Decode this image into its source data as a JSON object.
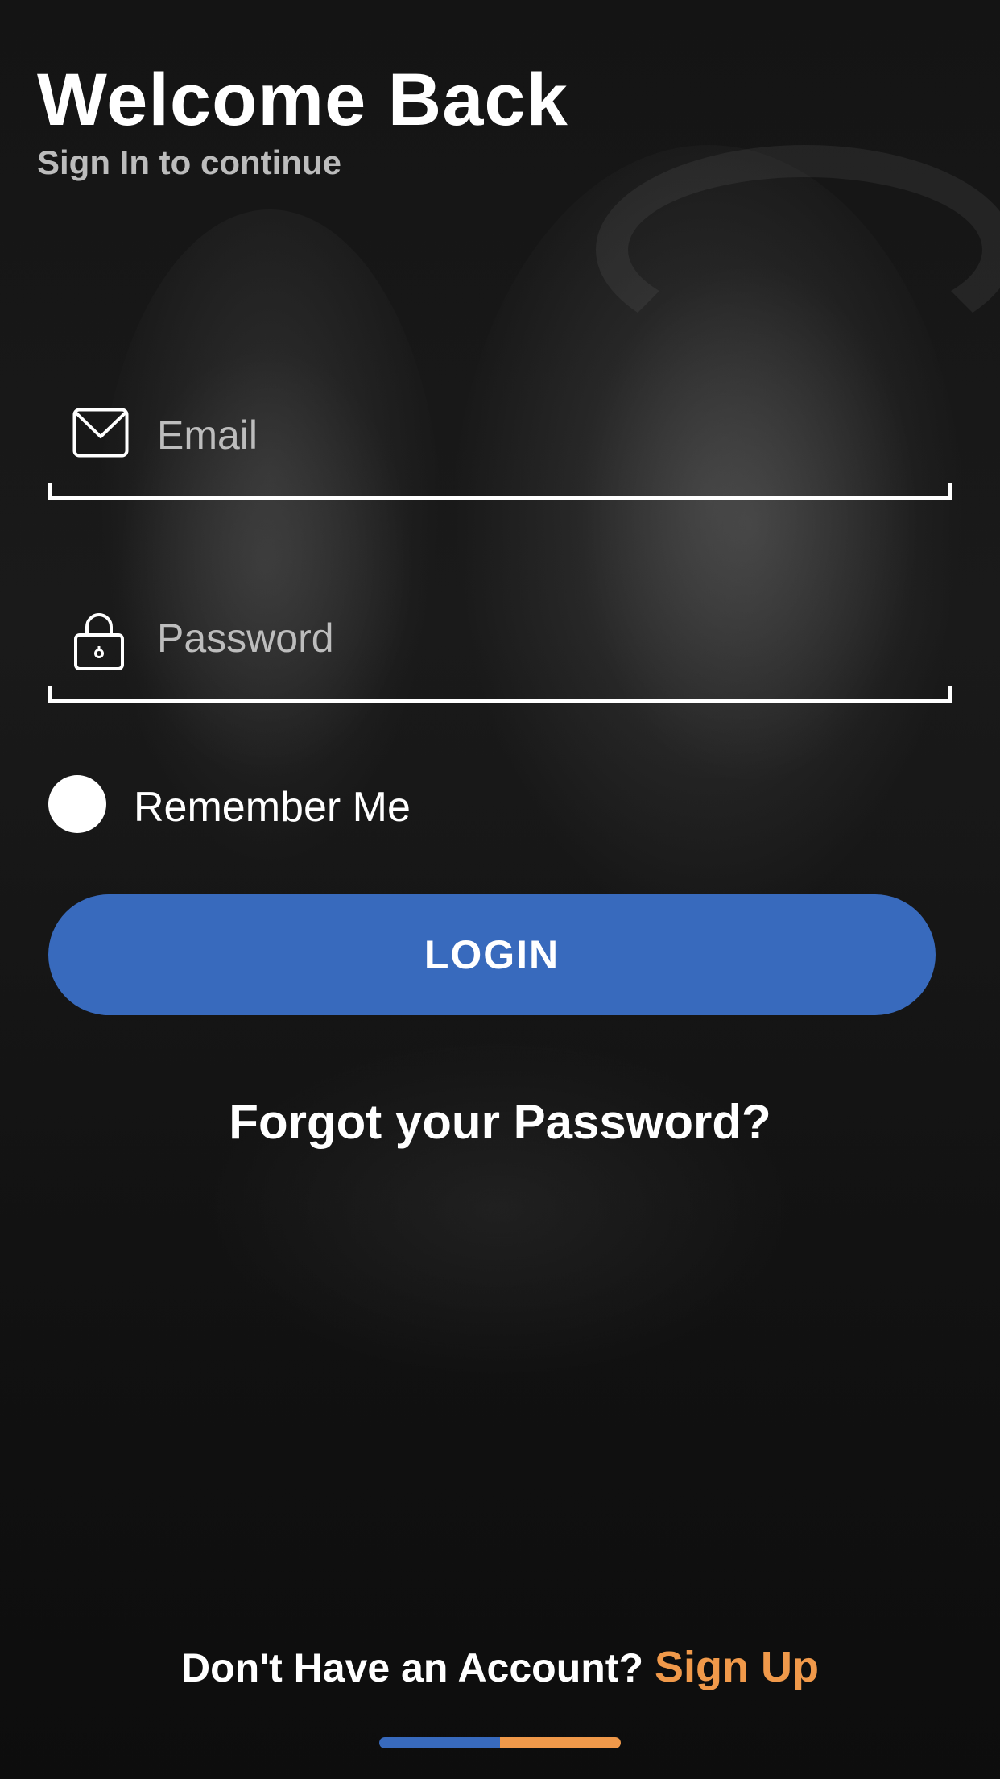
{
  "header": {
    "title": "Welcome Back",
    "subtitle": "Sign In to continue"
  },
  "form": {
    "email": {
      "placeholder": "Email",
      "value": "",
      "icon": "mail-icon"
    },
    "password": {
      "placeholder": "Password",
      "value": "",
      "icon": "lock-icon"
    },
    "remember_me": {
      "label": "Remember Me",
      "checked": false
    },
    "login_label": "LOGIN",
    "forgot_label": "Forgot your Password?"
  },
  "footer": {
    "question": "Don't Have an Account?",
    "signup_label": "Sign Up",
    "indicator": {
      "segments": 2,
      "active_color": "#386abd",
      "secondary_color": "#f0994a"
    }
  },
  "colors": {
    "primary": "#386abd",
    "accent": "#f0994a",
    "background": "#141414",
    "text": "#ffffff",
    "muted": "#bcbcbc"
  }
}
